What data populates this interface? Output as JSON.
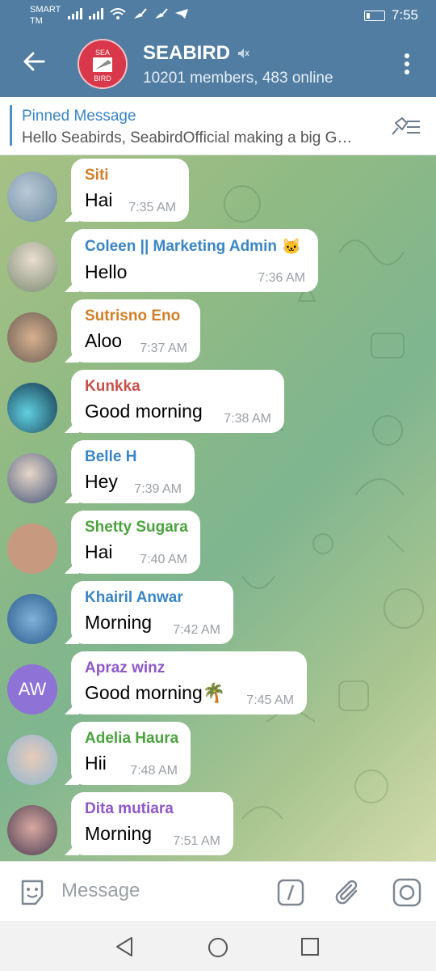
{
  "status_bar": {
    "carrier_line1": "SMART",
    "carrier_line2": "TM",
    "time": "7:55"
  },
  "header": {
    "title": "SEABIRD",
    "subtitle": "10201 members, 483 online",
    "logo_text_top": "SEA",
    "logo_text_bottom": "BIRD"
  },
  "pinned": {
    "title": "Pinned Message",
    "text": "Hello Seabirds, SeabirdOfficial  making a big G…"
  },
  "messages": [
    {
      "name": "Siti",
      "name_color": "#d0802b",
      "text": "Hai",
      "time": "7:35 AM"
    },
    {
      "name": "Coleen || Marketing Admin",
      "name_color": "#3a85c4",
      "text": "Hello",
      "time": "7:36 AM"
    },
    {
      "name": "Sutrisno Eno",
      "name_color": "#d0802b",
      "text": "Aloo",
      "time": "7:37 AM"
    },
    {
      "name": "Kunkka",
      "name_color": "#c7504a",
      "text": "Good morning",
      "time": "7:38 AM"
    },
    {
      "name": "Belle H",
      "name_color": "#3a85c4",
      "text": "Hey",
      "time": "7:39 AM"
    },
    {
      "name": "Shetty Sugara",
      "name_color": "#4aa33d",
      "text": "Hai",
      "time": "7:40 AM"
    },
    {
      "name": "Khairil Anwar",
      "name_color": "#3a85c4",
      "text": "Morning",
      "time": "7:42 AM"
    },
    {
      "name": "Apraz winz",
      "name_color": "#8e58c8",
      "text": "Good morning🌴",
      "time": "7:45 AM",
      "initials": "AW"
    },
    {
      "name": "Adelia Haura",
      "name_color": "#4aa33d",
      "text": "Hii",
      "time": "7:48 AM"
    },
    {
      "name": "Dita mutiara",
      "name_color": "#8e58c8",
      "text": "Morning",
      "time": "7:51 AM"
    }
  ],
  "input": {
    "placeholder": "Message"
  },
  "colors": {
    "header": "#517da2",
    "accent": "#3a85c4"
  },
  "icons": [
    "back-arrow-icon",
    "muted-icon",
    "more-icon",
    "pin-list-icon",
    "sticker-icon",
    "command-icon",
    "attach-icon",
    "camera-icon",
    "nav-back-icon",
    "nav-home-icon",
    "nav-recent-icon"
  ]
}
